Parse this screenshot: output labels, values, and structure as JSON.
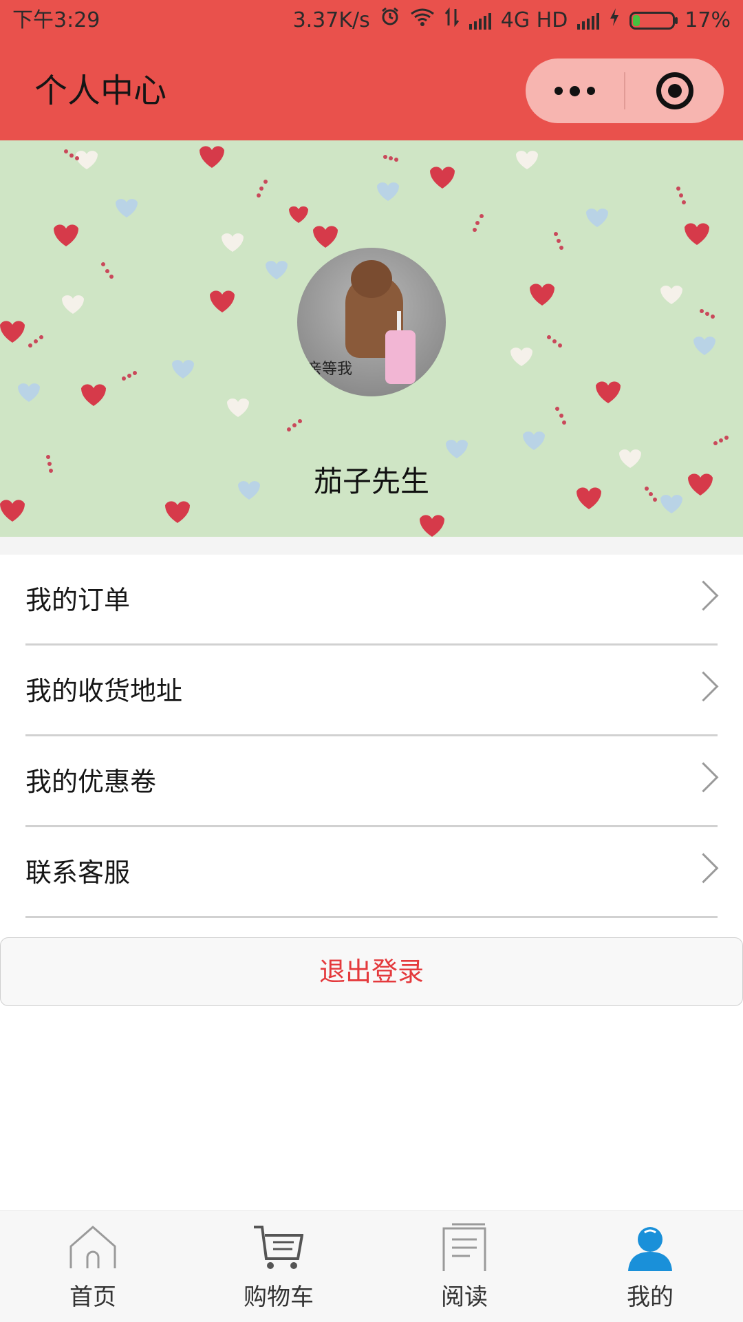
{
  "status_bar": {
    "time": "下午3:29",
    "net_speed": "3.37K/s",
    "network": "4G HD",
    "battery": "17%"
  },
  "header": {
    "title": "个人中心"
  },
  "profile": {
    "avatar_caption": "亲等我",
    "nickname": "茄子先生"
  },
  "menu": {
    "items": [
      {
        "label": "我的订单"
      },
      {
        "label": "我的收货地址"
      },
      {
        "label": "我的优惠卷"
      },
      {
        "label": "联系客服"
      }
    ]
  },
  "logout": {
    "label": "退出登录"
  },
  "tabbar": {
    "items": [
      {
        "label": "首页",
        "icon": "home-icon"
      },
      {
        "label": "购物车",
        "icon": "cart-icon"
      },
      {
        "label": "阅读",
        "icon": "document-icon"
      },
      {
        "label": "我的",
        "icon": "user-icon",
        "active": true
      }
    ]
  },
  "colors": {
    "brand": "#e9514c",
    "logout_text": "#e4393c",
    "active_tab_icon": "#1a90d9"
  }
}
